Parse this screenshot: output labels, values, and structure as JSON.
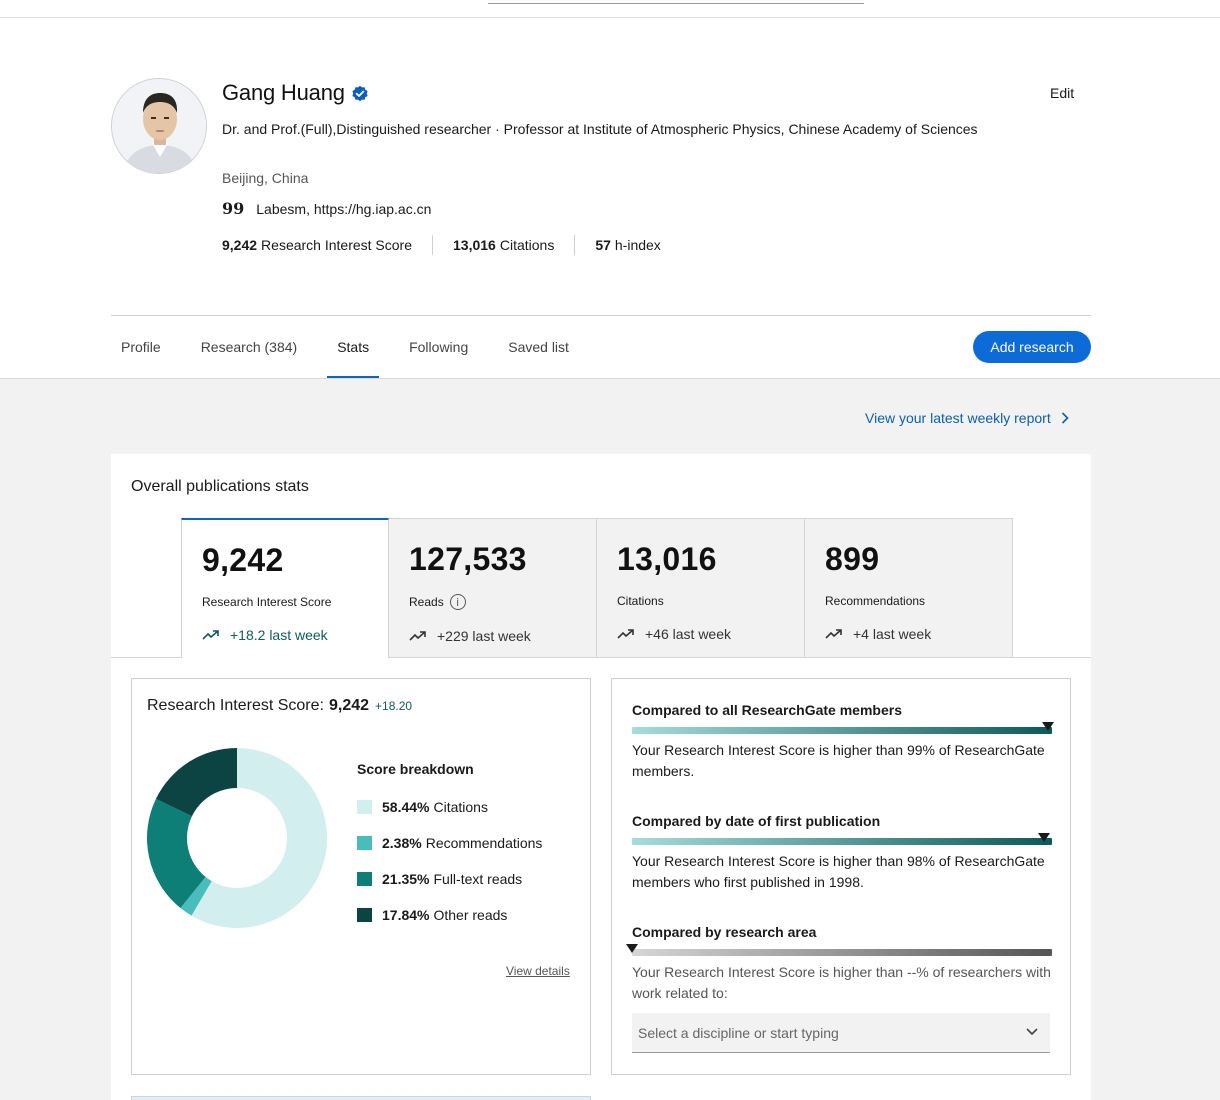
{
  "profile": {
    "name": "Gang Huang",
    "edit_label": "Edit",
    "headline": "Dr. and Prof.(Full),Distinguished researcher · Professor at Institute of Atmospheric Physics, Chinese Academy of Sciences",
    "location": "Beijing, China",
    "labs": "Labesm, https://hg.iap.ac.cn",
    "labs_icon": "quote-icon",
    "metrics": [
      {
        "value": "9,242",
        "label": "Research Interest Score"
      },
      {
        "value": "13,016",
        "label": "Citations"
      },
      {
        "value": "57",
        "label": "h-index"
      }
    ]
  },
  "tabs": [
    {
      "label": "Profile",
      "active": false
    },
    {
      "label": "Research (384)",
      "active": false
    },
    {
      "label": "Stats",
      "active": true
    },
    {
      "label": "Following",
      "active": false
    },
    {
      "label": "Saved list",
      "active": false
    }
  ],
  "add_research_label": "Add research",
  "weekly_report_link": "View your latest weekly report",
  "overall": {
    "title": "Overall publications stats",
    "stats": [
      {
        "value": "9,242",
        "label": "Research Interest Score",
        "delta": "+18.2 last week",
        "active": true
      },
      {
        "value": "127,533",
        "label": "Reads",
        "delta": "+229 last week",
        "active": false,
        "info": true
      },
      {
        "value": "13,016",
        "label": "Citations",
        "delta": "+46 last week",
        "active": false
      },
      {
        "value": "899",
        "label": "Recommendations",
        "delta": "+4 last week",
        "active": false
      }
    ]
  },
  "ris_panel": {
    "title_prefix": "Research Interest Score:",
    "value": "9,242",
    "delta": "+18.20",
    "breakdown_title": "Score breakdown",
    "breakdown": [
      {
        "pct": "58.44%",
        "label": "Citations",
        "value": 58.44,
        "color": "#d2eeee"
      },
      {
        "pct": "2.38%",
        "label": "Recommendations",
        "value": 2.38,
        "color": "#48bdbb"
      },
      {
        "pct": "21.35%",
        "label": "Full-text reads",
        "value": 21.35,
        "color": "#0d7f77"
      },
      {
        "pct": "17.84%",
        "label": "Other reads",
        "value": 17.84,
        "color": "#0c4443"
      }
    ],
    "view_details": "View details"
  },
  "comparisons": [
    {
      "title": "Compared to all ResearchGate members",
      "text": "Your Research Interest Score is higher than 99% of ResearchGate members.",
      "percentile": 99,
      "style": "teal"
    },
    {
      "title": "Compared by date of first publication",
      "text": "Your Research Interest Score is higher than 98% of ResearchGate members who first published in 1998.",
      "percentile": 98,
      "style": "teal"
    },
    {
      "title": "Compared by research area",
      "text": "Your Research Interest Score is higher than --% of researchers with work related to:",
      "percentile": 0,
      "style": "grey"
    }
  ],
  "discipline_select": {
    "placeholder": "Select a discipline or start typing",
    "icon": "chevron-down-icon"
  },
  "colors": {
    "accent": "#0c6bd6",
    "link": "#0a5fb4",
    "teal_dark": "#0c4443"
  }
}
